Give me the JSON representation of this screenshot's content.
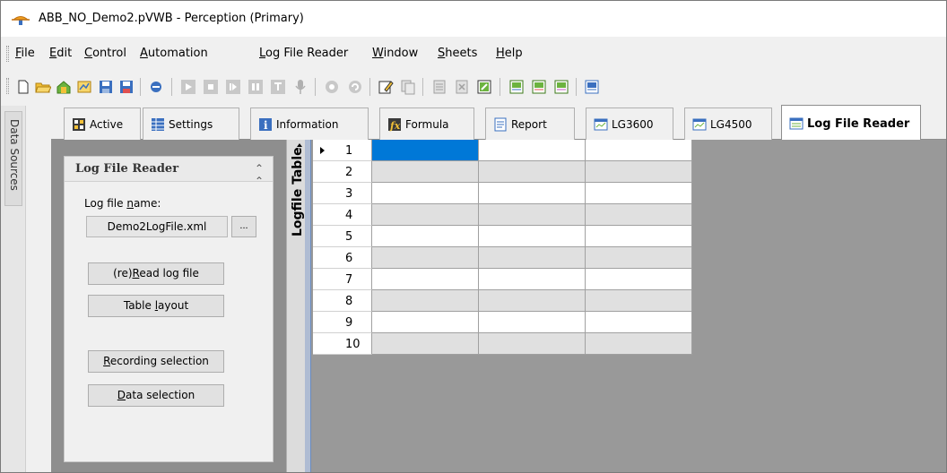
{
  "window": {
    "title": "ABB_NO_Demo2.pVWB - Perception (Primary)"
  },
  "menu": [
    {
      "label": "File",
      "ul": "F",
      "rest": "ile"
    },
    {
      "label": "Edit",
      "ul": "E",
      "rest": "dit"
    },
    {
      "label": "Control",
      "ul": "C",
      "rest": "ontrol"
    },
    {
      "label": "Automation",
      "ul": "A",
      "rest": "utomation"
    },
    {
      "label": "Log File Reader",
      "ul": "L",
      "rest": "og File Reader"
    },
    {
      "label": "Window",
      "ul": "W",
      "rest": "indow"
    },
    {
      "label": "Sheets",
      "ul": "S",
      "rest": "heets"
    },
    {
      "label": "Help",
      "ul": "H",
      "rest": "elp"
    }
  ],
  "sidebar": {
    "data_sources_label": "Data Sources"
  },
  "tabs": [
    {
      "label": "Active",
      "icon": "active-sheet-icon"
    },
    {
      "label": "Settings",
      "icon": "settings-sheet-icon"
    },
    {
      "label": "Information",
      "icon": "information-icon"
    },
    {
      "label": "Formula",
      "icon": "formula-icon"
    },
    {
      "label": "Report",
      "icon": "report-icon"
    },
    {
      "label": "LG3600",
      "icon": "lg-sheet-icon"
    },
    {
      "label": "LG4500",
      "icon": "lg-sheet-icon"
    },
    {
      "label": "Log File Reader",
      "icon": "log-file-reader-icon",
      "active": true
    }
  ],
  "panel": {
    "title": "Log File Reader",
    "file_label_pre": "Log file ",
    "file_label_ul": "n",
    "file_label_post": "ame:",
    "file_value": "Demo2LogFile.xml",
    "browse_label": "...",
    "reread_pre": "(re)",
    "reread_ul": "R",
    "reread_post": "ead log file",
    "table_layout_pre": "Table ",
    "table_layout_ul": "l",
    "table_layout_post": "ayout",
    "recording_ul": "R",
    "recording_post": "ecording selection",
    "data_ul": "D",
    "data_post": "ata selection"
  },
  "logfile_table": {
    "side_label": "Logfile Table",
    "rows": [
      "1",
      "2",
      "3",
      "4",
      "5",
      "6",
      "7",
      "8",
      "9",
      "10"
    ],
    "selected_row": 1,
    "columns": 3
  },
  "colors": {
    "selection": "#0078d7",
    "alt_row": "#e0e0e0",
    "workspace": "#999999"
  }
}
